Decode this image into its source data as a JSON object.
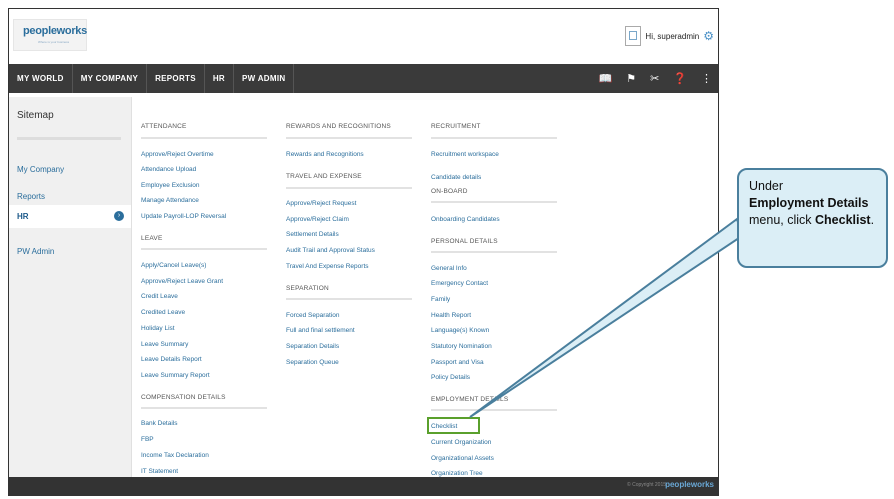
{
  "header": {
    "logo": "peopleworks",
    "logo_tagline": "Where is your business",
    "greeting": "Hi, superadmin"
  },
  "nav": {
    "items": [
      "MY WORLD",
      "MY COMPANY",
      "REPORTS",
      "HR",
      "PW ADMIN"
    ],
    "icons": [
      "book-icon",
      "flag-icon",
      "tools-icon",
      "help-icon",
      "share-icon"
    ]
  },
  "sidebar": {
    "title": "Sitemap",
    "items": [
      "My Company",
      "Reports",
      "HR",
      "PW Admin"
    ],
    "active": "HR"
  },
  "col1": {
    "attendance": {
      "head": "ATTENDANCE",
      "links": [
        "Approve/Reject Overtime",
        "Attendance Upload",
        "Employee Exclusion",
        "Manage Attendance",
        "Update Payroll-LOP Reversal"
      ]
    },
    "leave": {
      "head": "LEAVE",
      "links": [
        "Apply/Cancel Leave(s)",
        "Approve/Reject Leave Grant",
        "Credit Leave",
        "Credited Leave",
        "Holiday List",
        "Leave Summary",
        "Leave Details Report",
        "Leave Summary Report"
      ]
    },
    "compensation": {
      "head": "COMPENSATION DETAILS",
      "links": [
        "Bank Details",
        "FBP",
        "Income Tax Declaration",
        "IT Statement"
      ]
    }
  },
  "col2": {
    "rewards": {
      "head": "REWARDS AND RECOGNITIONS",
      "links": [
        "Rewards and Recognitions"
      ]
    },
    "travel": {
      "head": "TRAVEL AND EXPENSE",
      "links": [
        "Approve/Reject Request",
        "Approve/Reject Claim",
        "Settlement Details",
        "Audit Trail and Approval Status",
        "Travel And Expense Reports"
      ]
    },
    "separation": {
      "head": "SEPARATION",
      "links": [
        "Forced Separation",
        "Full and final settlement",
        "Separation Details",
        "Separation Queue"
      ]
    }
  },
  "col3": {
    "recruitment": {
      "head": "RECRUITMENT",
      "links": [
        "Recruitment workspace",
        "Candidate details"
      ]
    },
    "onboard": {
      "head": "ON-BOARD",
      "links": [
        "Onboarding Candidates"
      ]
    },
    "personal": {
      "head": "PERSONAL DETAILS",
      "links": [
        "General Info",
        "Emergency Contact",
        "Family",
        "Health Report",
        "Language(s) Known",
        "Statutory Nomination",
        "Passport and Visa",
        "Policy Details"
      ]
    },
    "employment": {
      "head": "EMPLOYMENT DETAILS",
      "links": [
        "Checklist",
        "Current Organization",
        "Organizational Assets",
        "Organization Tree"
      ]
    }
  },
  "footer": {
    "copyright": "© Copyright 2015",
    "logo": "peopleworks"
  },
  "callout": {
    "line1": "Under",
    "bold1": "Employment Details",
    "mid": " menu, click",
    "bold2": "Checklist",
    "end": "."
  },
  "colors": {
    "nav_bg": "#3a3a3a",
    "link": "#2b6e9c",
    "highlight": "#5aa02c",
    "callout_bg": "#dbeef6",
    "callout_border": "#4a7f9d"
  }
}
